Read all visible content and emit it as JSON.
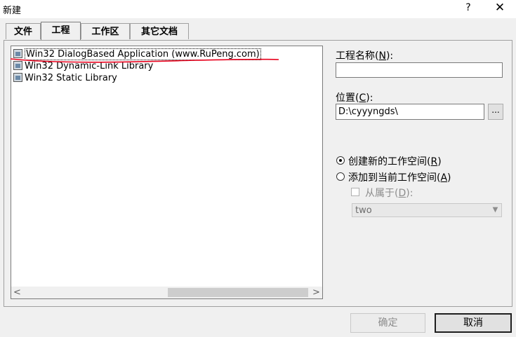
{
  "window": {
    "title": "新建",
    "help": "?",
    "close": "✕"
  },
  "tabs": [
    {
      "label": "文件",
      "active": false
    },
    {
      "label": "工程",
      "active": true
    },
    {
      "label": "工作区",
      "active": false
    },
    {
      "label": "其它文档",
      "active": false
    }
  ],
  "project_types": [
    {
      "label": "Win32 DialogBased Application (www.RuPeng.com)",
      "selected": true
    },
    {
      "label": "Win32 Dynamic-Link Library",
      "selected": false
    },
    {
      "label": "Win32 Static Library",
      "selected": false
    }
  ],
  "scrollbar": {
    "left": "<",
    "right": ">"
  },
  "project_name": {
    "label_pre": "工程名称(",
    "key": "N",
    "label_post": "):",
    "value": ""
  },
  "location": {
    "label_pre": "位置(",
    "key": "C",
    "label_post": "):",
    "value": "D:\\cyyyngds\\",
    "browse": "..."
  },
  "workspace": {
    "create_new": {
      "label_pre": "创建新的工作空间(",
      "key": "R",
      "label_post": ")",
      "checked": true
    },
    "add_current": {
      "label_pre": "添加到当前工作空间(",
      "key": "A",
      "label_post": ")",
      "checked": false
    },
    "dependency": {
      "label_pre": "从属于(",
      "key": "D",
      "label_post": "):",
      "checked": false,
      "enabled": false
    },
    "dependency_select": {
      "value": "two",
      "enabled": false
    }
  },
  "buttons": {
    "ok": "确定",
    "cancel": "取消"
  },
  "colors": {
    "annotation": "#e8001c"
  }
}
